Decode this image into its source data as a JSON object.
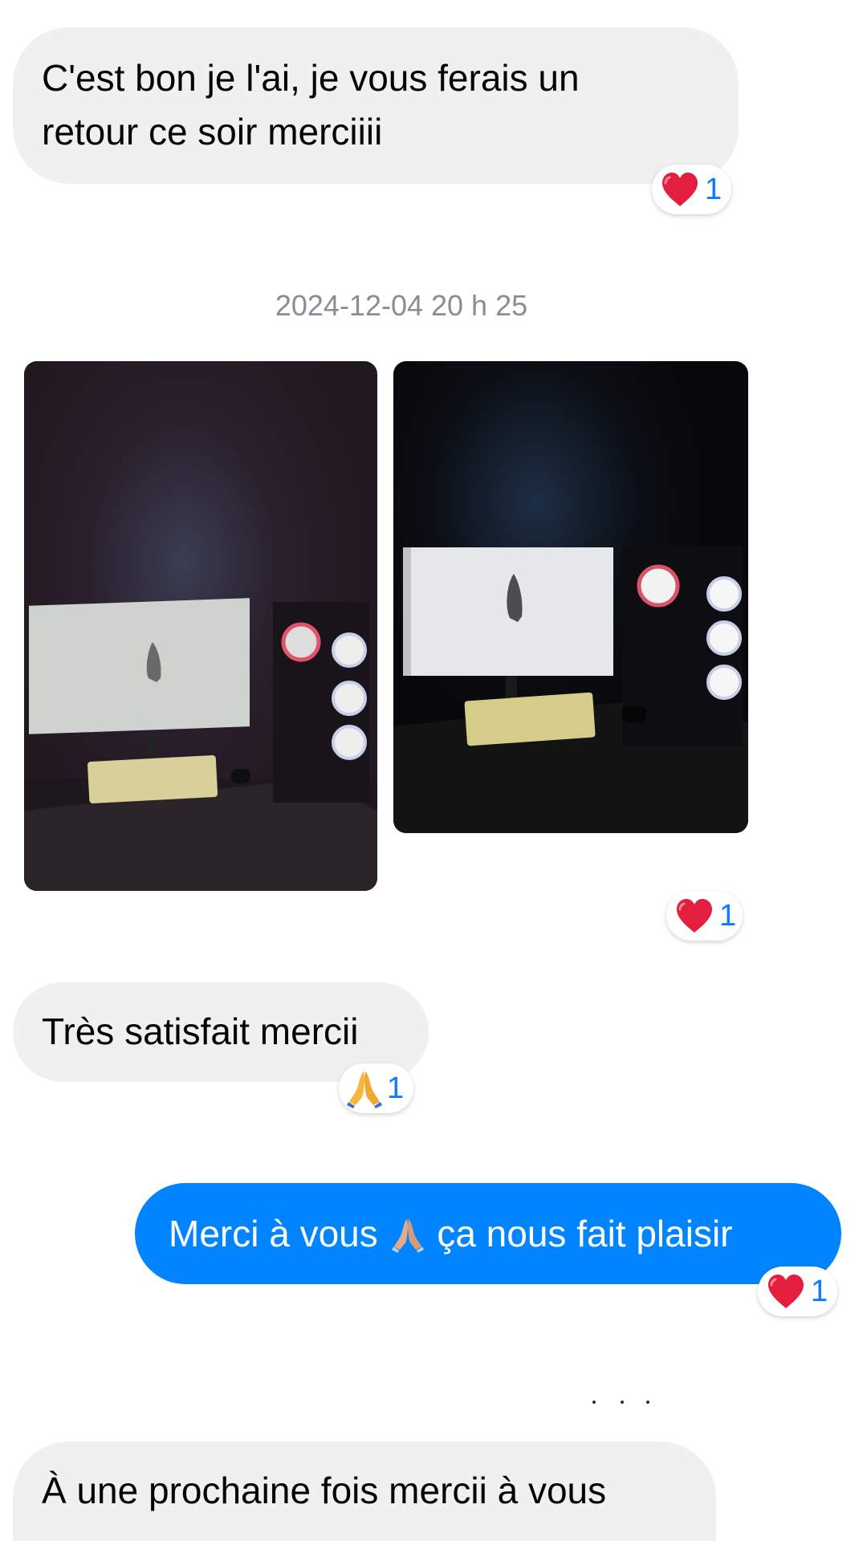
{
  "messages": {
    "msg1": {
      "line1": "C'est bon je l'ai, je vous ferais un",
      "line2": "retour ce soir merciiii",
      "reaction": {
        "icon": "heart-icon",
        "count": "1"
      }
    },
    "timestamp": "2024-12-04 20 h 25",
    "photos": {
      "reaction": {
        "icon": "heart-icon",
        "count": "1"
      }
    },
    "msg2": {
      "text": "Très satisfait mercii",
      "reaction": {
        "icon": "praying-hands-icon",
        "count": "1"
      }
    },
    "msg3": {
      "text_before": "Merci à vous",
      "text_after": "ça nous fait plaisir",
      "reaction": {
        "icon": "heart-icon",
        "count": "1"
      }
    },
    "msg4": {
      "text": "À une prochaine fois mercii à vous"
    }
  },
  "colors": {
    "incoming_bubble": "#f0f0f0",
    "outgoing_bubble": "#0084ff",
    "reaction_count": "#0a7cff",
    "heart": "#e8202f"
  }
}
